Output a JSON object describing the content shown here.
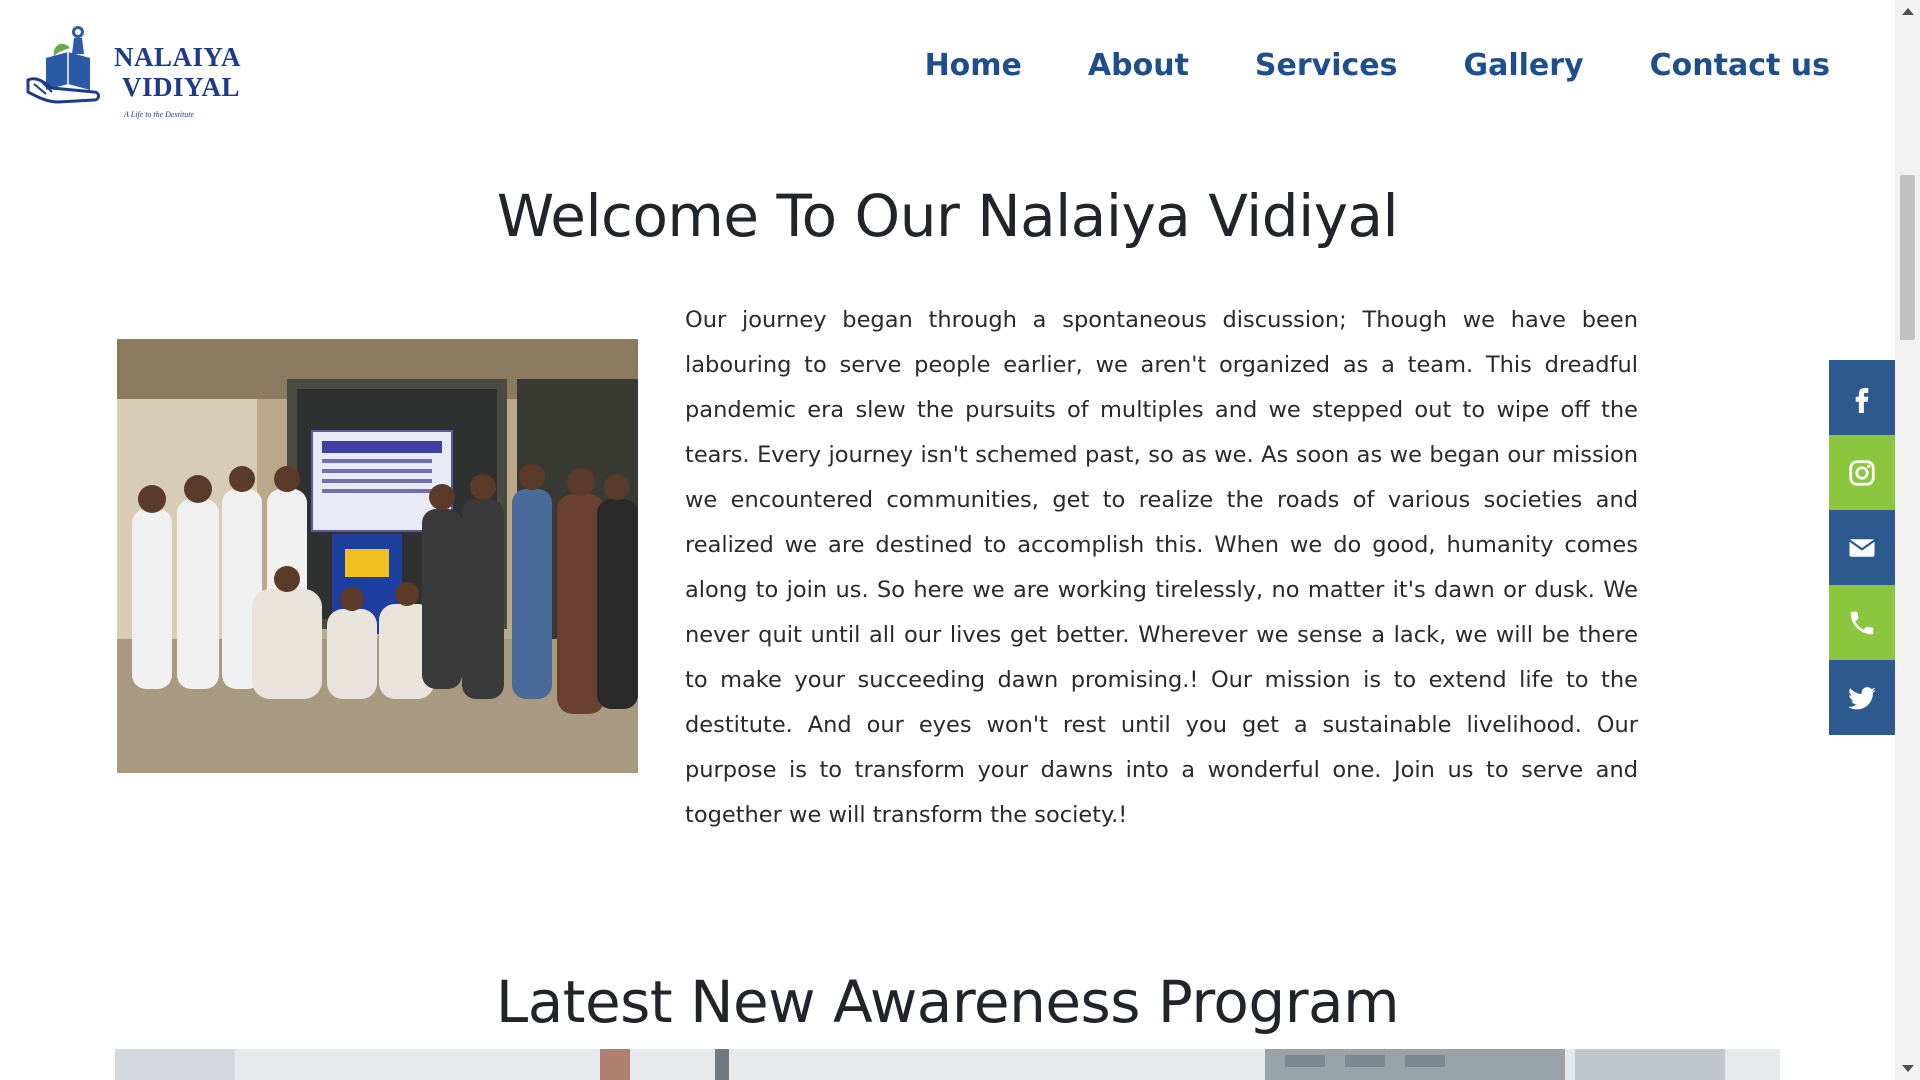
{
  "header": {
    "logo": {
      "line1": "NALAIYA",
      "line2": "VIDIYAL",
      "tagline": "A Life to the Destitute"
    },
    "nav": [
      {
        "label": "Home"
      },
      {
        "label": "About"
      },
      {
        "label": "Services"
      },
      {
        "label": "Gallery"
      },
      {
        "label": "Contact us"
      }
    ]
  },
  "welcome": {
    "title": "Welcome To Our Nalaiya Vidiyal",
    "photo_alt": "Group of volunteers at awareness program",
    "body": "Our journey began through a spontaneous discussion; Though we have been labouring to serve people earlier, we aren't organized as a team. This dreadful pandemic era slew the pursuits of multiples and we stepped out to wipe off the tears. Every journey isn't schemed past, so as we. As soon as we began our mission we encountered communities, get to realize the roads of various societies and realized we are destined to accomplish this. When we do good, humanity comes along to join us. So here we are working tirelessly, no matter it's dawn or dusk. We never quit until all our lives get better. Wherever we sense a lack, we will be there to make your succeeding dawn promising.! Our mission is to extend life to the destitute. And our eyes won't rest until you get a sustainable livelihood. Our purpose is to transform your dawns into a wonderful one. Join us to serve and together we will transform the society.!"
  },
  "social": [
    {
      "icon": "facebook-icon",
      "color": "#2d5a8e"
    },
    {
      "icon": "instagram-icon",
      "color": "#8cc63f"
    },
    {
      "icon": "envelope-icon",
      "color": "#2d5a8e"
    },
    {
      "icon": "phone-icon",
      "color": "#8cc63f"
    },
    {
      "icon": "twitter-icon",
      "color": "#2d5a8e"
    }
  ],
  "latest": {
    "title": "Latest New Awareness Program"
  },
  "colors": {
    "nav_text": "#1f4e8c",
    "social_blue": "#2d5a8e",
    "social_green": "#8cc63f",
    "heading": "#212529"
  }
}
